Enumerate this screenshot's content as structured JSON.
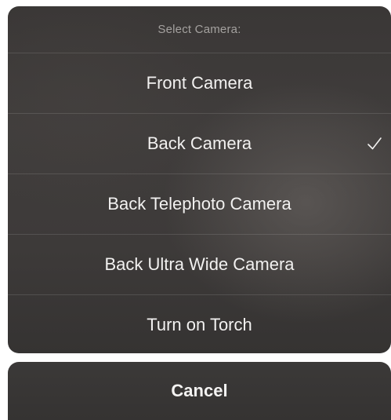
{
  "action_sheet": {
    "title": "Select Camera:",
    "options": [
      {
        "label": "Front Camera",
        "selected": false
      },
      {
        "label": "Back Camera",
        "selected": true
      },
      {
        "label": "Back Telephoto Camera",
        "selected": false
      },
      {
        "label": "Back Ultra Wide Camera",
        "selected": false
      },
      {
        "label": "Turn on Torch",
        "selected": false
      }
    ],
    "selected_icon": "checkmark-icon"
  },
  "cancel": {
    "label": "Cancel"
  },
  "colors": {
    "sheet_background": "#3d3a39",
    "title_text": "#a4a19f",
    "option_text": "#f2f1f0",
    "divider": "#565352"
  }
}
